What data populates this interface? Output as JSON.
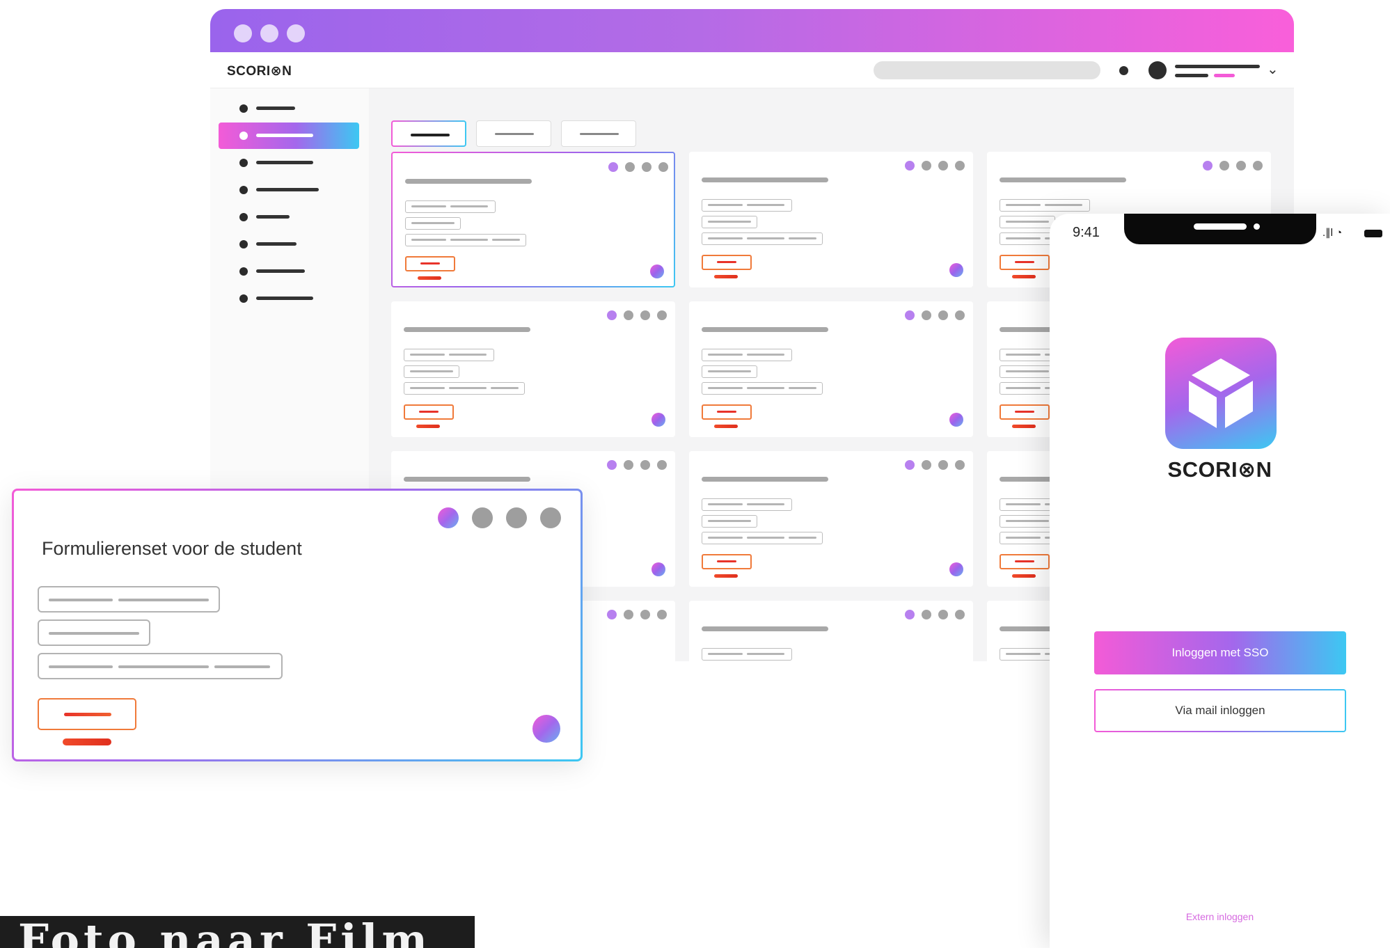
{
  "app": {
    "logo_text": "SCORI⊗N"
  },
  "form_card": {
    "title": "Formulierenset voor de student"
  },
  "phone": {
    "time": "9:41",
    "signal_glyphs": ".∥l ◔",
    "app_name": "SCORI⊗N",
    "sso_button_label": "Inloggen met SSO",
    "mail_button_label": "Via mail inloggen",
    "extern_link_label": "Extern inloggen"
  },
  "watermark": {
    "text": "Foto naar Film"
  },
  "colors": {
    "accent_pink": "#f35bd7",
    "accent_purple": "#a467ec",
    "accent_cyan": "#3cc8f2",
    "action_red": "#e8332a"
  },
  "icons": {
    "logo_mark": "gear-o-icon",
    "app_icon": "cube-icon",
    "menu_chevron": "chevron-down-icon",
    "status_wifi": "wifi-icon",
    "status_battery": "battery-icon"
  }
}
